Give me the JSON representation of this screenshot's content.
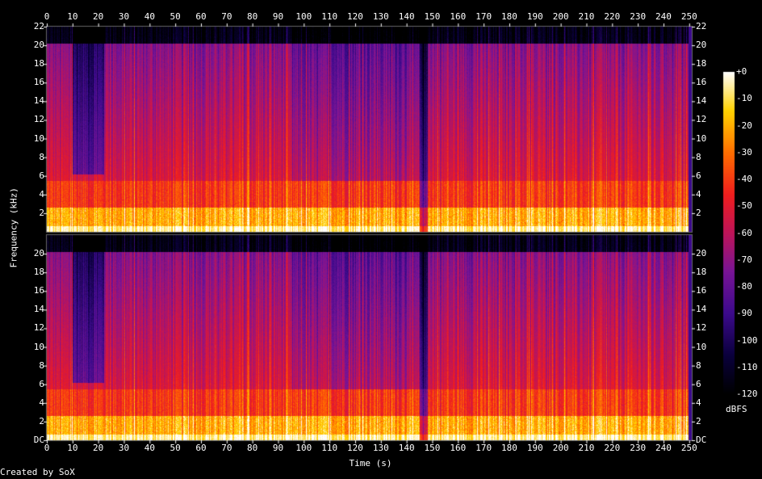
{
  "credit": "Created by SoX",
  "chart_data": {
    "type": "heatmap",
    "title": "",
    "xlabel": "Time (s)",
    "ylabel": "Frequency (kHz)",
    "x_ticks": [
      "0",
      "10",
      "20",
      "30",
      "40",
      "50",
      "60",
      "70",
      "80",
      "90",
      "100",
      "110",
      "120",
      "130",
      "140",
      "150",
      "160",
      "170",
      "180",
      "190",
      "200",
      "210",
      "220",
      "230",
      "240",
      "250"
    ],
    "xlim": [
      0,
      251
    ],
    "channels": [
      {
        "y_ticks": [
          "22",
          "20",
          "18",
          "16",
          "14",
          "12",
          "10",
          "8",
          "6",
          "4",
          "2"
        ]
      },
      {
        "y_ticks": [
          "20",
          "18",
          "16",
          "14",
          "12",
          "10",
          "8",
          "6",
          "4",
          "2",
          "DC"
        ]
      }
    ],
    "ylim_khz": [
      0,
      22
    ],
    "colorbar": {
      "label": "dBFS",
      "ticks": [
        "+0",
        "-10",
        "-20",
        "-30",
        "-40",
        "-50",
        "-60",
        "-70",
        "-80",
        "-90",
        "-100",
        "-110",
        "-120"
      ],
      "range": [
        -120,
        0
      ]
    }
  }
}
